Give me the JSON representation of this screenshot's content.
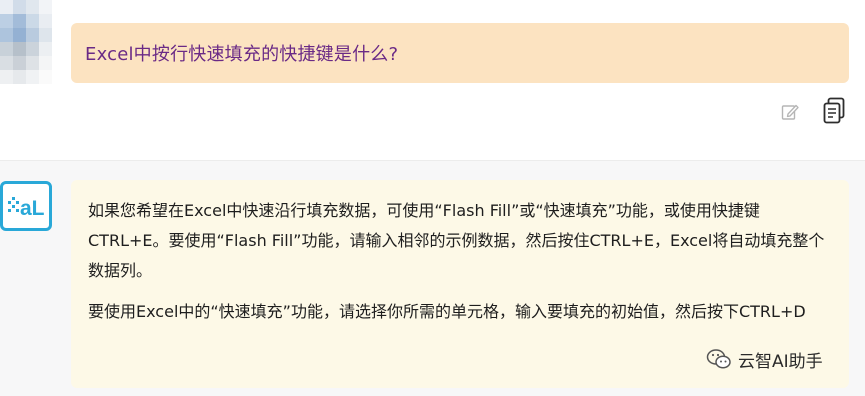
{
  "user_message": {
    "text": "Excel中按行快速填充的快捷键是什么?"
  },
  "message_actions": {
    "edit_icon": "edit-icon",
    "copy_icon": "copy-icon"
  },
  "assistant_message": {
    "paragraphs": [
      "如果您希望在Excel中快速沿行填充数据，可使用“Flash Fill”或“快速填充”功能，或使用快捷键CTRL+E。要使用“Flash Fill”功能，请输入相邻的示例数据，然后按住CTRL+E，Excel将自动填充整个数据列。",
      "要使用Excel中的“快速填充”功能，请选择你所需的单元格，输入要填充的初始值，然后按下CTRL+D"
    ]
  },
  "watermark": {
    "text": "云智AI助手"
  },
  "colors": {
    "user_bubble": "#fce3c1",
    "user_text": "#6a2a86",
    "assistant_bubble": "#fdf9e7",
    "assistant_section": "#f7f7f8",
    "ai_avatar_accent": "#29a8d8"
  }
}
